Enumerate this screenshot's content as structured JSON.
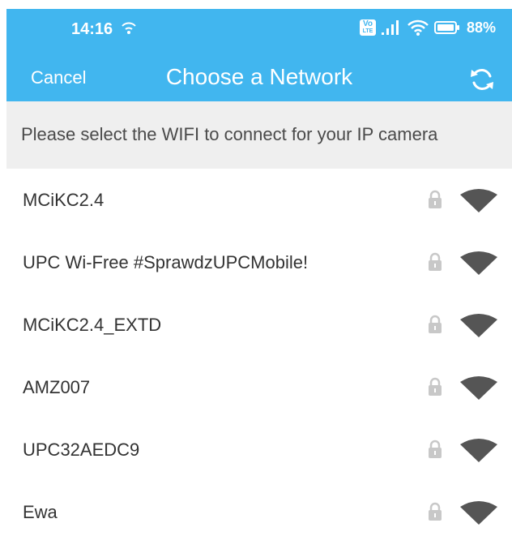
{
  "status_bar": {
    "time": "14:16",
    "volte_top": "Vo",
    "volte_bottom": "LTE",
    "battery": "88%"
  },
  "nav": {
    "cancel_label": "Cancel",
    "title": "Choose a Network",
    "refresh_icon": "refresh-icon"
  },
  "instruction": "Please select the WIFI to connect for your IP camera",
  "networks": [
    {
      "ssid": "MCiKC2.4",
      "secured": true
    },
    {
      "ssid": "UPC Wi-Free #SprawdzUPCMobile!",
      "secured": true
    },
    {
      "ssid": "MCiKC2.4_EXTD",
      "secured": true
    },
    {
      "ssid": "AMZ007",
      "secured": true
    },
    {
      "ssid": "UPC32AEDC9",
      "secured": true
    },
    {
      "ssid": "Ewa",
      "secured": true
    }
  ],
  "colors": {
    "header": "#41b6ef",
    "subheader_bg": "#efefef",
    "wifi_icon": "#555555",
    "lock_icon": "#c8c8c8"
  }
}
